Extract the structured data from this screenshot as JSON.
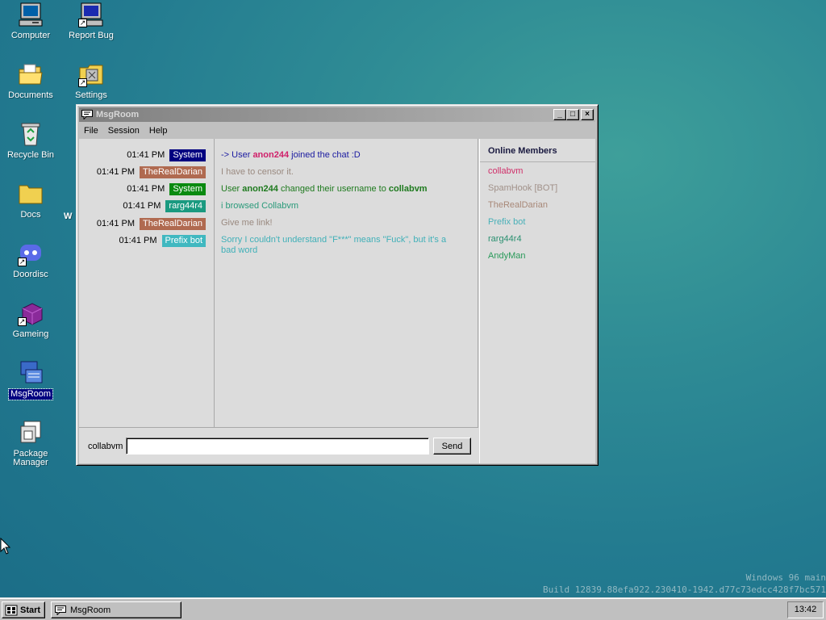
{
  "desktop": {
    "icons": [
      {
        "label": "Computer",
        "icon": "computer-icon"
      },
      {
        "label": "Report Bug",
        "icon": "report-bug-icon"
      },
      {
        "label": "Documents",
        "icon": "documents-folder-icon"
      },
      {
        "label": "Settings",
        "icon": "settings-icon"
      },
      {
        "label": "Recycle Bin",
        "icon": "recycle-bin-icon"
      },
      {
        "label": "Docs",
        "icon": "folder-icon"
      },
      {
        "label": "Doordisc",
        "icon": "doordisc-icon"
      },
      {
        "label": "Gameing",
        "icon": "gameing-icon"
      },
      {
        "label": "MsgRoom",
        "icon": "msgroom-icon"
      },
      {
        "label": "Package Manager",
        "icon": "package-manager-icon"
      }
    ],
    "partial_label": "W",
    "watermark_line1": "Windows 96 main",
    "watermark_line2": "Build 12839.88efa922.230410-1942.d77c73edcc428f7bc571"
  },
  "window": {
    "title": "MsgRoom",
    "minimize": "_",
    "maximize": "□",
    "close": "×",
    "menu": [
      "File",
      "Session",
      "Help"
    ],
    "messages": [
      {
        "time": "01:41 PM",
        "user": "System",
        "badge_color": "#000080",
        "text_color": "#1a1aa0",
        "parts": [
          {
            "t": "-> User ",
            "b": false
          },
          {
            "t": "anon244",
            "b": true,
            "c": "#d0206a"
          },
          {
            "t": " joined the chat :D",
            "b": false
          }
        ]
      },
      {
        "time": "01:41 PM",
        "user": "TheRealDarian",
        "badge_color": "#b06a50",
        "text_color": "#9a8a80",
        "parts": [
          {
            "t": "I have to censor it.",
            "b": false
          }
        ]
      },
      {
        "time": "01:41 PM",
        "user": "System",
        "badge_color": "#0a8a10",
        "text_color": "#1e7a1e",
        "parts": [
          {
            "t": "User ",
            "b": false
          },
          {
            "t": "anon244",
            "b": true
          },
          {
            "t": " changed their username to ",
            "b": false
          },
          {
            "t": "collabvm",
            "b": true
          }
        ]
      },
      {
        "time": "01:41 PM",
        "user": "rarg44r4",
        "badge_color": "#1a9a80",
        "text_color": "#2a9a7a",
        "parts": [
          {
            "t": "i browsed Collabvm",
            "b": false
          }
        ]
      },
      {
        "time": "01:41 PM",
        "user": "TheRealDarian",
        "badge_color": "#b06a50",
        "text_color": "#9a8a80",
        "parts": [
          {
            "t": "Give me link!",
            "b": false
          }
        ]
      },
      {
        "time": "01:41 PM",
        "user": "Prefix bot",
        "badge_color": "#40b8c0",
        "text_color": "#40b0b8",
        "parts": [
          {
            "t": "Sorry I couldn't understand \"F***\" means \"Fuck\", but it's a bad word",
            "b": false
          }
        ]
      }
    ],
    "members_title": "Online Members",
    "members": [
      {
        "name": "collabvm",
        "color": "#d0306a"
      },
      {
        "name": "SpamHook [BOT]",
        "color": "#a09088"
      },
      {
        "name": "TheRealDarian",
        "color": "#a88878"
      },
      {
        "name": "Prefix bot",
        "color": "#48b0b8"
      },
      {
        "name": "rarg44r4",
        "color": "#2a9070"
      },
      {
        "name": "AndyMan",
        "color": "#2a9a5a"
      }
    ],
    "input": {
      "username": "collabvm",
      "value": "",
      "placeholder": "",
      "send_label": "Send"
    }
  },
  "taskbar": {
    "start_label": "Start",
    "items": [
      {
        "label": "MsgRoom"
      }
    ],
    "clock": "13:42"
  }
}
